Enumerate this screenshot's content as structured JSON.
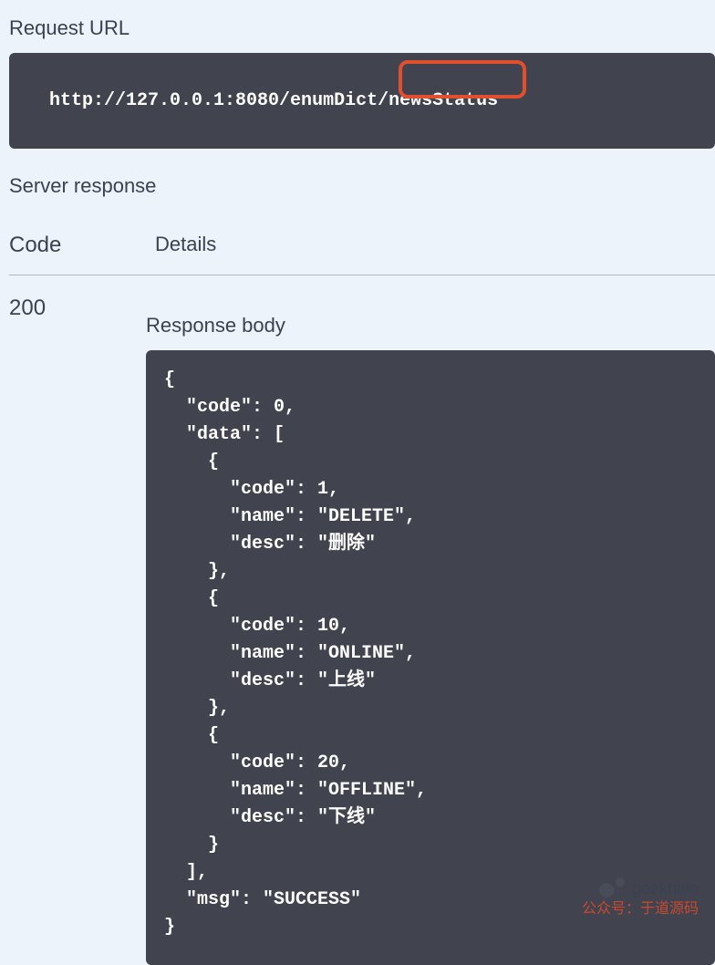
{
  "labels": {
    "request_url": "Request URL",
    "server_response": "Server response",
    "code_header": "Code",
    "details_header": "Details",
    "response_body": "Response body"
  },
  "request": {
    "url_full": "http://127.0.0.1:8080/enumDict/newsStatus",
    "highlighted_segment": "newsStatus"
  },
  "response": {
    "status_code": "200",
    "body_text": "{\n  \"code\": 0,\n  \"data\": [\n    {\n      \"code\": 1,\n      \"name\": \"DELETE\",\n      \"desc\": \"删除\"\n    },\n    {\n      \"code\": 10,\n      \"name\": \"ONLINE\",\n      \"desc\": \"上线\"\n    },\n    {\n      \"code\": 20,\n      \"name\": \"OFFLINE\",\n      \"desc\": \"下线\"\n    }\n  ],\n  \"msg\": \"SUCCESS\"\n}",
    "body_json": {
      "code": 0,
      "data": [
        {
          "code": 1,
          "name": "DELETE",
          "desc": "删除"
        },
        {
          "code": 10,
          "name": "ONLINE",
          "desc": "上线"
        },
        {
          "code": 20,
          "name": "OFFLINE",
          "desc": "下线"
        }
      ],
      "msg": "SUCCESS"
    }
  },
  "watermark": {
    "handle": "geekhalo",
    "subtitle": "公众号：于道源码"
  }
}
